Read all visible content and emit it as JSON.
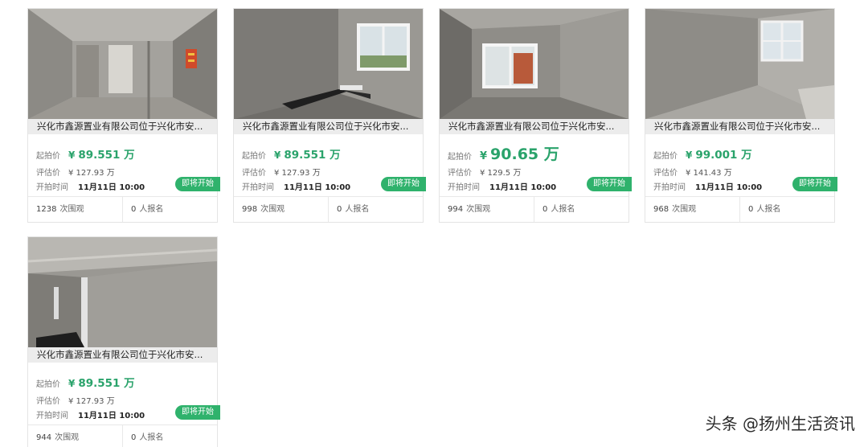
{
  "listings": [
    {
      "title": "兴化市鑫源置业有限公司位于兴化市安...",
      "start_price_label": "起拍价",
      "currency": "¥",
      "start_price": "89.551 万",
      "appraisal_label": "评估价",
      "appraisal_price": "¥ 127.93 万",
      "start_time_label": "开拍时间",
      "start_time": "11月11日 10:00",
      "status": "即将开始",
      "views_count": "1238",
      "views_unit": "次围观",
      "signup_count": "0",
      "signup_unit": "人报名",
      "photo_icon": "corridor-photo"
    },
    {
      "title": "兴化市鑫源置业有限公司位于兴化市安...",
      "start_price_label": "起拍价",
      "currency": "¥",
      "start_price": "89.551 万",
      "appraisal_label": "评估价",
      "appraisal_price": "¥ 127.93 万",
      "start_time_label": "开拍时间",
      "start_time": "11月11日 10:00",
      "status": "即将开始",
      "views_count": "998",
      "views_unit": "次围观",
      "signup_count": "0",
      "signup_unit": "人报名",
      "photo_icon": "room-window-photo"
    },
    {
      "title": "兴化市鑫源置业有限公司位于兴化市安...",
      "start_price_label": "起拍价",
      "currency": "¥",
      "start_price": "90.65 万",
      "appraisal_label": "评估价",
      "appraisal_price": "¥ 129.5 万",
      "start_time_label": "开拍时间",
      "start_time": "11月11日 10:00",
      "status": "即将开始",
      "views_count": "994",
      "views_unit": "次围观",
      "signup_count": "0",
      "signup_unit": "人报名",
      "photo_icon": "room-window-photo"
    },
    {
      "title": "兴化市鑫源置业有限公司位于兴化市安...",
      "start_price_label": "起拍价",
      "currency": "¥",
      "start_price": "99.001 万",
      "appraisal_label": "评估价",
      "appraisal_price": "¥ 141.43 万",
      "start_time_label": "开拍时间",
      "start_time": "11月11日 10:00",
      "status": "即将开始",
      "views_count": "968",
      "views_unit": "次围观",
      "signup_count": "0",
      "signup_unit": "人报名",
      "photo_icon": "room-window-photo"
    },
    {
      "title": "兴化市鑫源置业有限公司位于兴化市安...",
      "start_price_label": "起拍价",
      "currency": "¥",
      "start_price": "89.551 万",
      "appraisal_label": "评估价",
      "appraisal_price": "¥ 127.93 万",
      "start_time_label": "开拍时间",
      "start_time": "11月11日 10:00",
      "status": "即将开始",
      "views_count": "944",
      "views_unit": "次围观",
      "signup_count": "0",
      "signup_unit": "人报名",
      "photo_icon": "room-photo"
    }
  ],
  "watermark": "头条 @扬州生活资讯",
  "colors": {
    "price_green": "#2aa36b",
    "badge_green": "#2fb26c",
    "title_bar_bg": "#ececec"
  }
}
